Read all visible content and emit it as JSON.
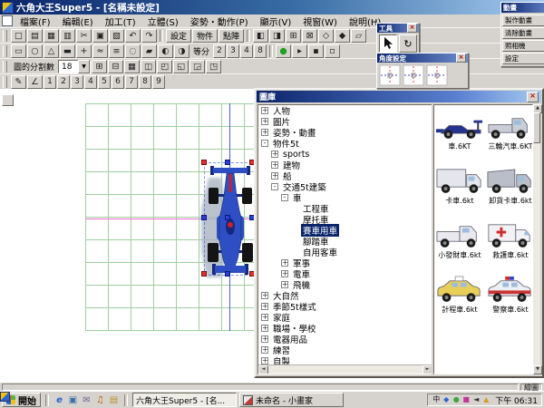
{
  "window": {
    "title": "六角大王Super5 - [名稱未設定]"
  },
  "menu": [
    "檔案(F)",
    "編輯(E)",
    "加工(T)",
    "立體(S)",
    "姿勢・動作(P)",
    "顯示(V)",
    "視窗(W)",
    "說明(H)"
  ],
  "toolbar": {
    "row1_icons": [
      {
        "name": "new-file-icon",
        "glyph": "□"
      },
      {
        "name": "open-file-icon",
        "glyph": "▤"
      },
      {
        "name": "save-icon",
        "glyph": "▦"
      },
      {
        "name": "print-icon",
        "glyph": "▥"
      },
      {
        "name": "cut-icon",
        "glyph": "✂"
      },
      {
        "name": "copy-icon",
        "glyph": "▣"
      },
      {
        "name": "paste-icon",
        "glyph": "▧"
      },
      {
        "name": "undo-icon",
        "glyph": "↶"
      },
      {
        "name": "redo-icon",
        "glyph": "↷"
      }
    ],
    "mode_buttons": [
      "設定",
      "物件",
      "點陣"
    ],
    "row1b_icons": [
      {
        "name": "toolbar-icon",
        "glyph": "◧"
      },
      {
        "name": "toolbar-icon",
        "glyph": "◨"
      },
      {
        "name": "toolbar-icon",
        "glyph": "⊞"
      },
      {
        "name": "toolbar-icon",
        "glyph": "⊠"
      },
      {
        "name": "toolbar-icon",
        "glyph": "◇"
      },
      {
        "name": "toolbar-icon",
        "glyph": "◆"
      },
      {
        "name": "toolbar-icon",
        "glyph": "▱"
      }
    ],
    "row2_icons": [
      {
        "name": "select-tool-icon",
        "glyph": "▭"
      },
      {
        "name": "circle-tool-icon",
        "glyph": "○"
      },
      {
        "name": "triangle-tool-icon",
        "glyph": "△"
      },
      {
        "name": "line-tool-icon",
        "glyph": "▬"
      },
      {
        "name": "add-point-icon",
        "glyph": "+"
      },
      {
        "name": "wave-tool-icon",
        "glyph": "≈"
      },
      {
        "name": "layers-icon",
        "glyph": "≡"
      },
      {
        "name": "toolbar-icon",
        "glyph": "◌"
      },
      {
        "name": "toolbar-icon",
        "glyph": "▰"
      },
      {
        "name": "toolbar-icon",
        "glyph": "◐"
      },
      {
        "name": "toolbar-icon",
        "glyph": "◑"
      }
    ],
    "divide_label": "等分",
    "divide_values": [
      "2",
      "3",
      "4",
      "8"
    ],
    "row2b_icons": [
      {
        "name": "render-icon",
        "glyph": "●",
        "color": "#1fa01f"
      },
      {
        "name": "toolbar-icon",
        "glyph": "▸"
      },
      {
        "name": "toolbar-icon",
        "glyph": "▪"
      },
      {
        "name": "toolbar-icon",
        "glyph": "▫"
      }
    ],
    "row3_label": "圖的分割數",
    "row3_value": "18",
    "row3_icons": [
      {
        "name": "grid-icon",
        "glyph": "⊞"
      },
      {
        "name": "grid-minus-icon",
        "glyph": "⊟"
      },
      {
        "name": "mesh-icon",
        "glyph": "▦"
      },
      {
        "name": "toolbar-icon",
        "glyph": "◫"
      },
      {
        "name": "toolbar-icon",
        "glyph": "◰"
      },
      {
        "name": "toolbar-icon",
        "glyph": "◱"
      },
      {
        "name": "toolbar-icon",
        "glyph": "◲"
      },
      {
        "name": "toolbar-icon",
        "glyph": "◳"
      }
    ],
    "row4_icons": [
      {
        "name": "pencil-icon",
        "glyph": "✎"
      },
      {
        "name": "measure-icon",
        "glyph": "∠"
      }
    ],
    "digits": [
      "1",
      "2",
      "3",
      "4",
      "5",
      "6",
      "7",
      "8",
      "9"
    ]
  },
  "palettes": {
    "tools": {
      "title": "工具"
    },
    "angle": {
      "title": "角度設定"
    },
    "animation": {
      "title": "動畫",
      "buttons": [
        "製作動畫",
        "清除動畫",
        "照相機",
        "設定"
      ]
    }
  },
  "library": {
    "title": "圖庫",
    "tree": [
      {
        "label": "人物",
        "level": 1,
        "box": "+"
      },
      {
        "label": "圖片",
        "level": 1,
        "box": "+"
      },
      {
        "label": "姿勢・動畫",
        "level": 1,
        "box": "+"
      },
      {
        "label": "物件5t",
        "level": 1,
        "box": "-"
      },
      {
        "label": "sports",
        "level": 2,
        "box": "+"
      },
      {
        "label": "建物",
        "level": 2,
        "box": "+"
      },
      {
        "label": "船",
        "level": 2,
        "box": "+"
      },
      {
        "label": "交通5t建築",
        "level": 2,
        "box": "-"
      },
      {
        "label": "車",
        "level": 3,
        "box": "-"
      },
      {
        "label": "工程車",
        "level": 4,
        "box": ""
      },
      {
        "label": "摩托車",
        "level": 4,
        "box": ""
      },
      {
        "label": "賽車用車",
        "level": 4,
        "box": "",
        "selected": true
      },
      {
        "label": "腳踏車",
        "level": 4,
        "box": ""
      },
      {
        "label": "自用客車",
        "level": 4,
        "box": ""
      },
      {
        "label": "軍事",
        "level": 3,
        "box": "+"
      },
      {
        "label": "電車",
        "level": 3,
        "box": "+"
      },
      {
        "label": "飛機",
        "level": 3,
        "box": "+"
      },
      {
        "label": "大自然",
        "level": 1,
        "box": "+"
      },
      {
        "label": "季節5t樣式",
        "level": 1,
        "box": "+"
      },
      {
        "label": "家庭",
        "level": 1,
        "box": "+"
      },
      {
        "label": "職場・學校",
        "level": 1,
        "box": "+"
      },
      {
        "label": "電器用品",
        "level": 1,
        "box": "+"
      },
      {
        "label": "練習",
        "level": 1,
        "box": "+"
      },
      {
        "label": "自製",
        "level": 1,
        "box": "+"
      }
    ],
    "thumbnails": [
      {
        "label": "車.6KT",
        "type": "f1",
        "color": "#24338f"
      },
      {
        "label": "三輪汽車.6KT",
        "type": "threewheel",
        "color": "#c8cdd6"
      },
      {
        "label": "卡車.6kt",
        "type": "truck",
        "color": "#e4e6ec"
      },
      {
        "label": "卸貨卡車.6kt",
        "type": "dump",
        "color": "#b9bec8"
      },
      {
        "label": "小發財車.6kt",
        "type": "pickup",
        "color": "#e8e8ee"
      },
      {
        "label": "救護車.6kt",
        "type": "ambulance",
        "color": "#f2f2f6"
      },
      {
        "label": "計程車.6kt",
        "type": "taxi",
        "color": "#e7cf5a"
      },
      {
        "label": "警察車.6kt",
        "type": "police",
        "color": "#eceff3"
      }
    ]
  },
  "statusbar": {
    "right": "繪圖"
  },
  "taskbar": {
    "start_label": "開始",
    "quick_icons": [
      {
        "name": "internet-explorer-icon",
        "glyph": "e",
        "color": "#2a66cf"
      },
      {
        "name": "show-desktop-icon",
        "glyph": "▣",
        "color": "#3a6ea5"
      },
      {
        "name": "mail-icon",
        "glyph": "✉",
        "color": "#6a6a9a"
      },
      {
        "name": "media-player-icon",
        "glyph": "♫",
        "color": "#c06000"
      },
      {
        "name": "folder-icon",
        "glyph": "▤",
        "color": "#b8932f"
      }
    ],
    "tasks": [
      {
        "label": "六角大王Super5 - [名...",
        "icon": "app",
        "active": true
      },
      {
        "label": "未命名 - 小畫家",
        "icon": "paint",
        "active": false
      }
    ],
    "tray_icons": [
      {
        "name": "ime-indicator",
        "glyph": "中",
        "color": "#1a1a1a"
      },
      {
        "name": "tray-icon",
        "glyph": "◆",
        "color": "#2a66cf"
      },
      {
        "name": "tray-icon",
        "glyph": "●",
        "color": "#3fa33f"
      },
      {
        "name": "tray-icon",
        "glyph": "■",
        "color": "#c03a9a"
      },
      {
        "name": "volume-icon",
        "glyph": "◄",
        "color": "#333333"
      },
      {
        "name": "tray-icon",
        "glyph": "▲",
        "color": "#d0a020"
      }
    ],
    "clock": "下午 06:31"
  },
  "colors": {
    "grid_line": "#9fcf9f",
    "car_body": "#2e4fc4",
    "car_dark": "#16277e",
    "guide_v": "#4a5ae0",
    "guide_h": "#ef6fd0",
    "handle_red": "#e03131",
    "handle_blue": "#2b3fd6",
    "shadow": "#a9b4c2"
  }
}
